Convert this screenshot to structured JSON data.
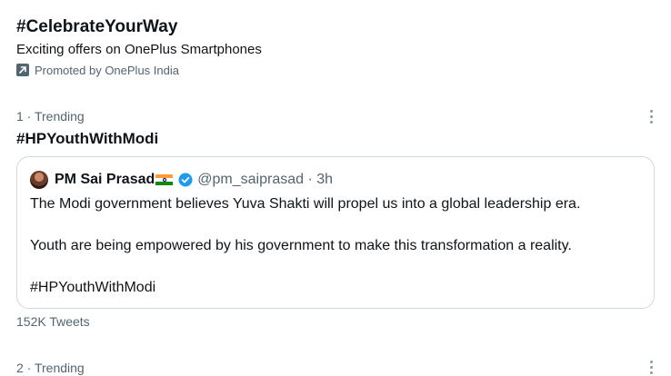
{
  "promoted": {
    "title": "#CelebrateYourWay",
    "subtitle": "Exciting offers on OnePlus Smartphones",
    "promoted_by": "Promoted by OnePlus India",
    "icon": "promoted-arrow-icon"
  },
  "trends": [
    {
      "meta": "1 · Trending",
      "title": "#HPYouthWithModi",
      "more_icon": "more-options-icon",
      "quoted_tweet": {
        "author_name": "PM Sai Prasad",
        "flag": "india-flag-icon",
        "verified_icon": "verified-badge-icon",
        "handle_time": "@pm_saiprasad · 3h",
        "paragraphs": [
          "The Modi government believes Yuva Shakti will propel us into a global leadership era.",
          "Youth are being empowered by his government to make this transformation a reality.",
          "#HPYouthWithModi"
        ]
      },
      "tweet_count": "152K Tweets"
    },
    {
      "meta": "2 · Trending",
      "more_icon": "more-options-icon"
    }
  ],
  "colors": {
    "text_primary": "#0f1419",
    "text_secondary": "#536471",
    "border": "#cfd9de",
    "verified": "#1d9bf0"
  }
}
